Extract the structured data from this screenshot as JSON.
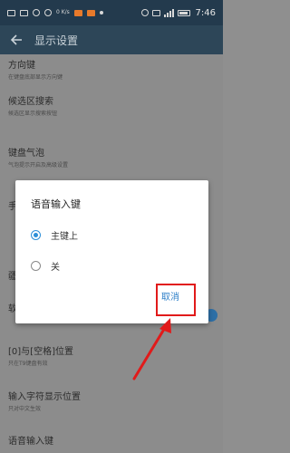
{
  "status_bar": {
    "network_speed": "0 K/s",
    "time": "7:46"
  },
  "app_bar": {
    "title": "显示设置"
  },
  "settings": {
    "direction_keys": {
      "title": "方向键",
      "subtitle": "在键盘底部显示方向键"
    },
    "candidate_search": {
      "title": "候选区搜索",
      "subtitle": "候选区显示搜索按钮"
    },
    "key_bubble": {
      "title": "键盘气泡",
      "subtitle": "气泡提示开启及高级设置"
    },
    "space_position": {
      "title": "[0]与[空格]位置",
      "subtitle": "只在T9键盘有效"
    },
    "input_char_position": {
      "title": "输入字符显示位置",
      "subtitle": "只对中文生效"
    },
    "voice_key": {
      "title": "语音输入键"
    }
  },
  "partial_letters": {
    "a": "手",
    "b": "疆",
    "c": "软"
  },
  "dialog": {
    "title": "语音输入键",
    "options": [
      {
        "label": "主键上",
        "selected": true
      },
      {
        "label": "关",
        "selected": false
      }
    ],
    "cancel_label": "取消"
  },
  "colors": {
    "accent": "#2d8fd8",
    "highlight": "#e11a1a",
    "app_bar": "#2d4658"
  }
}
